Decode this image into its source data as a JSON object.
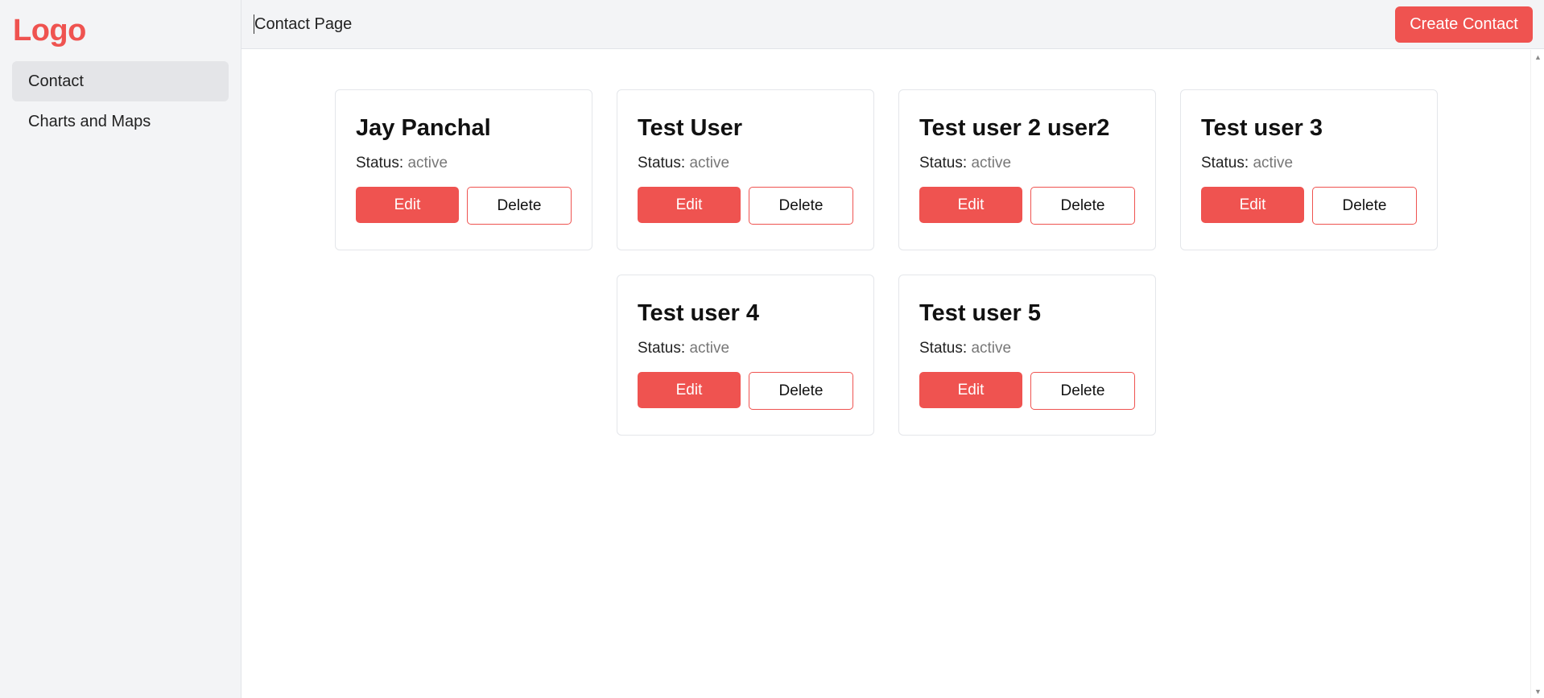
{
  "sidebar": {
    "logo": "Logo",
    "items": [
      {
        "label": "Contact",
        "active": true
      },
      {
        "label": "Charts and Maps",
        "active": false
      }
    ]
  },
  "header": {
    "title": "Contact Page",
    "create_label": "Create Contact"
  },
  "cards": {
    "status_label": "Status:",
    "edit_label": "Edit",
    "delete_label": "Delete",
    "items": [
      {
        "name": "Jay Panchal",
        "status": "active"
      },
      {
        "name": "Test User",
        "status": "active"
      },
      {
        "name": "Test user 2 user2",
        "status": "active"
      },
      {
        "name": "Test user 3",
        "status": "active"
      },
      {
        "name": "Test user 4",
        "status": "active"
      },
      {
        "name": "Test user 5",
        "status": "active"
      }
    ]
  },
  "colors": {
    "accent": "#ef5350",
    "sidebar_bg": "#f3f4f6",
    "active_nav_bg": "#e4e5e8",
    "status_value": "#777777"
  },
  "icons": {
    "scroll_up": "scroll-up-arrow-icon",
    "scroll_down": "scroll-down-arrow-icon"
  }
}
